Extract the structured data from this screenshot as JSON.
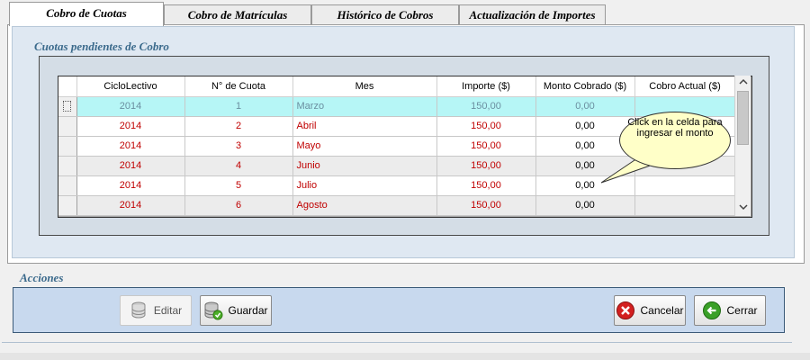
{
  "tabs": [
    {
      "label": "Cobro de Cuotas",
      "active": true
    },
    {
      "label": "Cobro de Matrículas",
      "active": false
    },
    {
      "label": "Histórico de Cobros",
      "active": false
    },
    {
      "label": "Actualización de Importes",
      "active": false
    }
  ],
  "cuotas_group": {
    "title": "Cuotas pendientes de Cobro",
    "columns": [
      "CicloLectivo",
      "N° de Cuota",
      "Mes",
      "Importe ($)",
      "Monto Cobrado ($)",
      "Cobro Actual ($)"
    ],
    "rows": [
      {
        "ciclo": "2014",
        "cuota": "1",
        "mes": "Marzo",
        "importe": "150,00",
        "cobrado": "0,00",
        "actual": "",
        "selected": true
      },
      {
        "ciclo": "2014",
        "cuota": "2",
        "mes": "Abril",
        "importe": "150,00",
        "cobrado": "0,00",
        "actual": "",
        "selected": false
      },
      {
        "ciclo": "2014",
        "cuota": "3",
        "mes": "Mayo",
        "importe": "150,00",
        "cobrado": "0,00",
        "actual": "",
        "selected": false
      },
      {
        "ciclo": "2014",
        "cuota": "4",
        "mes": "Junio",
        "importe": "150,00",
        "cobrado": "0,00",
        "actual": "",
        "selected": false
      },
      {
        "ciclo": "2014",
        "cuota": "5",
        "mes": "Julio",
        "importe": "150,00",
        "cobrado": "0,00",
        "actual": "",
        "selected": false
      },
      {
        "ciclo": "2014",
        "cuota": "6",
        "mes": "Agosto",
        "importe": "150,00",
        "cobrado": "0,00",
        "actual": "",
        "selected": false
      }
    ],
    "tooltip": "Click en la celda para ingresar el monto"
  },
  "acciones_group": {
    "title": "Acciones",
    "buttons": {
      "editar": "Editar",
      "guardar": "Guardar",
      "cancelar": "Cancelar",
      "cerrar": "Cerrar"
    }
  },
  "colors": {
    "selected_row": "#b6f6f6",
    "text_red": "#c00000",
    "group_title": "#3b6a8c",
    "tooltip_bg": "#ffffc8"
  },
  "icons": {
    "editar": "database-edit-icon",
    "guardar": "database-save-icon",
    "cancelar": "cancel-icon",
    "cerrar": "back-arrow-icon",
    "scroll_up": "chevron-up-icon",
    "scroll_down": "chevron-down-icon"
  }
}
